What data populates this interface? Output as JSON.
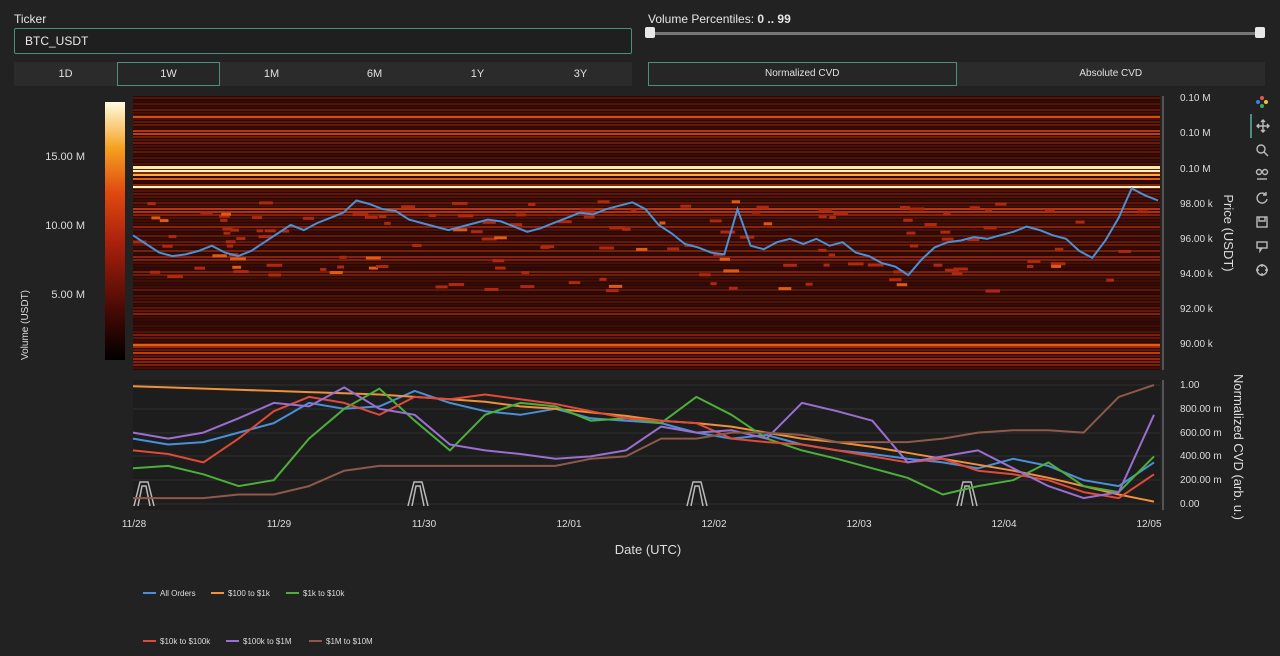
{
  "controls": {
    "ticker_label": "Ticker",
    "ticker_value": "BTC_USDT",
    "volume_percentiles_label": "Volume Percentiles:",
    "volume_percentiles_value": "0 .. 99",
    "timeframes": [
      "1D",
      "1W",
      "1M",
      "6M",
      "1Y",
      "3Y"
    ],
    "active_timeframe": "1W",
    "cvd_modes": [
      "Normalized CVD",
      "Absolute CVD"
    ],
    "active_cvd_mode": "Normalized CVD",
    "slider_range": [
      0,
      99
    ]
  },
  "colors": {
    "accent": "#4a8f7f",
    "price_line": "#4a90d9",
    "background": "#222222"
  },
  "modebar_icons": [
    "plotly-logo-icon",
    "pan-icon",
    "zoom-icon",
    "autoscale-icon",
    "reset-icon",
    "download-icon",
    "hover-compare-icon",
    "spike-lines-icon"
  ],
  "chart_data": [
    {
      "type": "heatmap",
      "x_ticks": [
        "11/28",
        "11/29",
        "11/30",
        "12/01",
        "12/02",
        "12/03",
        "12/04",
        "12/05"
      ],
      "xlabel": "Date (UTC)",
      "ylabel": "Price (USDT)",
      "y_ticks": [
        "0.10 M",
        "0.10 M",
        "0.10 M",
        "98.00 k",
        "96.00 k",
        "94.00 k",
        "92.00 k",
        "90.00 k"
      ],
      "colorbar_label": "Volume (USDT)",
      "colorbar_ticks": [
        "15.00 M",
        "10.00 M",
        "5.00 M"
      ],
      "price_series": [
        96200,
        95700,
        95200,
        95000,
        95100,
        95300,
        95600,
        95200,
        95000,
        95300,
        95800,
        96300,
        96800,
        96500,
        96900,
        97200,
        97500,
        98200,
        98000,
        97700,
        97600,
        97100,
        96900,
        96700,
        96500,
        96700,
        96900,
        97100,
        97000,
        96700,
        96400,
        96600,
        96900,
        97200,
        97500,
        97400,
        97700,
        97900,
        98100,
        97700,
        96800,
        96300,
        95700,
        95500,
        95200,
        95100,
        97700,
        95600,
        95400,
        95800,
        96000,
        95700,
        96000,
        95600,
        95800,
        95200,
        95000,
        94600,
        94400,
        93900,
        94800,
        95500,
        95800,
        95900,
        96100,
        96000,
        96200,
        96400,
        96700,
        96500,
        96200,
        96000,
        95300,
        94900,
        95900,
        97200,
        98900,
        98500,
        98200
      ]
    },
    {
      "type": "line",
      "ylabel": "Normalized CVD (arb. u.)",
      "y_ticks": [
        "1.00",
        "800.00 m",
        "600.00 m",
        "400.00 m",
        "200.00 m",
        "0.00"
      ],
      "ylim": [
        0,
        1
      ],
      "series": [
        {
          "name": "All Orders",
          "color": "#4a90d9",
          "values": [
            0.55,
            0.5,
            0.52,
            0.6,
            0.68,
            0.85,
            0.8,
            0.82,
            0.95,
            0.85,
            0.78,
            0.75,
            0.8,
            0.72,
            0.7,
            0.68,
            0.6,
            0.55,
            0.58,
            0.5,
            0.45,
            0.42,
            0.38,
            0.35,
            0.3,
            0.38,
            0.32,
            0.2,
            0.15,
            0.35
          ]
        },
        {
          "name": "$100 to $1k",
          "color": "#f0913a",
          "values": [
            0.99,
            0.98,
            0.97,
            0.96,
            0.95,
            0.94,
            0.93,
            0.92,
            0.9,
            0.88,
            0.86,
            0.82,
            0.8,
            0.77,
            0.74,
            0.7,
            0.68,
            0.65,
            0.6,
            0.55,
            0.52,
            0.48,
            0.43,
            0.38,
            0.33,
            0.28,
            0.22,
            0.15,
            0.08,
            0.02
          ]
        },
        {
          "name": "$1k to $10k",
          "color": "#4caf3a",
          "values": [
            0.3,
            0.32,
            0.25,
            0.15,
            0.2,
            0.55,
            0.8,
            0.97,
            0.7,
            0.45,
            0.75,
            0.85,
            0.82,
            0.7,
            0.72,
            0.68,
            0.9,
            0.75,
            0.55,
            0.45,
            0.38,
            0.3,
            0.22,
            0.08,
            0.15,
            0.2,
            0.35,
            0.15,
            0.1,
            0.4
          ]
        },
        {
          "name": "$10k to $100k",
          "color": "#e04a3a",
          "values": [
            0.45,
            0.42,
            0.35,
            0.55,
            0.78,
            0.9,
            0.85,
            0.75,
            0.9,
            0.88,
            0.92,
            0.88,
            0.84,
            0.78,
            0.72,
            0.7,
            0.68,
            0.55,
            0.52,
            0.5,
            0.45,
            0.4,
            0.35,
            0.38,
            0.28,
            0.25,
            0.2,
            0.1,
            0.05,
            0.25
          ]
        },
        {
          "name": "$100k to $1M",
          "color": "#9a6fd1",
          "values": [
            0.6,
            0.55,
            0.6,
            0.72,
            0.85,
            0.82,
            0.98,
            0.8,
            0.75,
            0.5,
            0.45,
            0.42,
            0.38,
            0.4,
            0.45,
            0.65,
            0.6,
            0.62,
            0.55,
            0.85,
            0.78,
            0.7,
            0.35,
            0.4,
            0.45,
            0.3,
            0.15,
            0.05,
            0.1,
            0.75
          ]
        },
        {
          "name": "$1M to $10M",
          "color": "#8d5a4a",
          "values": [
            0.05,
            0.05,
            0.05,
            0.08,
            0.08,
            0.15,
            0.28,
            0.32,
            0.32,
            0.32,
            0.32,
            0.32,
            0.32,
            0.38,
            0.4,
            0.55,
            0.55,
            0.6,
            0.6,
            0.58,
            0.52,
            0.52,
            0.52,
            0.55,
            0.6,
            0.62,
            0.62,
            0.6,
            0.9,
            1.0
          ]
        }
      ]
    }
  ]
}
